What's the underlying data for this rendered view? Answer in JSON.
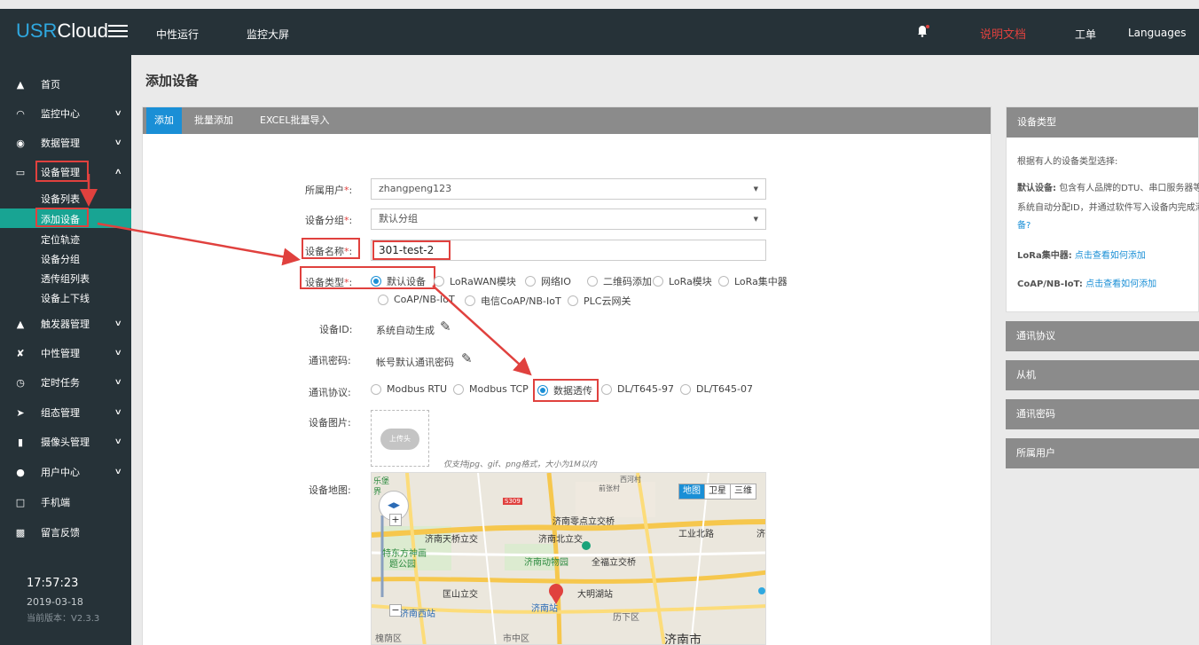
{
  "topbar": {
    "logo_usr": "USR",
    "logo_cloud": "Cloud",
    "nav1": "中性运行",
    "nav2": "监控大屏",
    "docs": "说明文档",
    "ticket": "工单",
    "languages": "Languages"
  },
  "sidebar": {
    "home": "首页",
    "monitor": "监控中心",
    "data": "数据管理",
    "device": "设备管理",
    "device_list": "设备列表",
    "add_device": "添加设备",
    "track": "定位轨迹",
    "group": "设备分组",
    "transparent": "透传组列表",
    "online": "设备上下线",
    "trigger": "触发器管理",
    "neutral": "中性管理",
    "timer": "定时任务",
    "config": "组态管理",
    "camera": "摄像头管理",
    "user": "用户中心",
    "mobile": "手机端",
    "feedback": "留言反馈",
    "time": "17:57:23",
    "date": "2019-03-18",
    "version": "当前版本：V2.3.3"
  },
  "page": {
    "title": "添加设备"
  },
  "tabs": {
    "add": "添加",
    "batch": "批量添加",
    "excel": "EXCEL批量导入"
  },
  "form": {
    "owner_label": "所属用户",
    "owner_value": "zhangpeng123",
    "group_label": "设备分组",
    "group_value": "默认分组",
    "name_label": "设备名称",
    "name_value": "301-test-2",
    "type_label": "设备类型",
    "types": [
      "默认设备",
      "LoRaWAN模块",
      "网络IO",
      "二维码添加",
      "LoRa模块",
      "LoRa集中器",
      "CoAP/NB-IoT",
      "电信CoAP/NB-IoT",
      "PLC云网关"
    ],
    "id_label": "设备ID:",
    "id_value": "系统自动生成",
    "pwd_label": "通讯密码:",
    "pwd_value": "帐号默认通讯密码",
    "proto_label": "通讯协议:",
    "protocols": [
      "Modbus RTU",
      "Modbus TCP",
      "数据透传",
      "DL/T645-97",
      "DL/T645-07"
    ],
    "img_label": "设备图片:",
    "img_hint": "仅支持jpg、gif、png格式，大小为1M以内",
    "upload_text": "上传头",
    "map_label": "设备地图:",
    "colon": ":",
    "req": "*"
  },
  "map": {
    "btn_map": "地图",
    "btn_sat": "卫星",
    "btn_3d": "三维",
    "labels": [
      "济南零点立交桥",
      "济南天桥立交",
      "济南北立交",
      "工业北路",
      "特东方神画",
      "题公园",
      "济南动物园",
      "全福立交桥",
      "匡山立交",
      "大明湖站",
      "济南站",
      "济南西站",
      "历下区",
      "槐荫区",
      "市中区",
      "济南市",
      "西河村",
      "前张村",
      "乐堡",
      "界",
      "S309",
      "济"
    ]
  },
  "right": {
    "type_title": "设备类型",
    "intro": "根据有人的设备类型选择:",
    "default_label": "默认设备:",
    "default_text": "包含有人品牌的DTU、串口服务器等",
    "default_text2": "系统自动分配ID，并通过软件写入设备内完成添加",
    "default_text3": "备?",
    "lora_label": "LoRa集中器:",
    "lora_link": "点击查看如何添加",
    "coap_label": "CoAP/NB-IoT:",
    "coap_link": "点击查看如何添加",
    "proto": "通讯协议",
    "slave": "从机",
    "pwd": "通讯密码",
    "owner": "所属用户"
  }
}
